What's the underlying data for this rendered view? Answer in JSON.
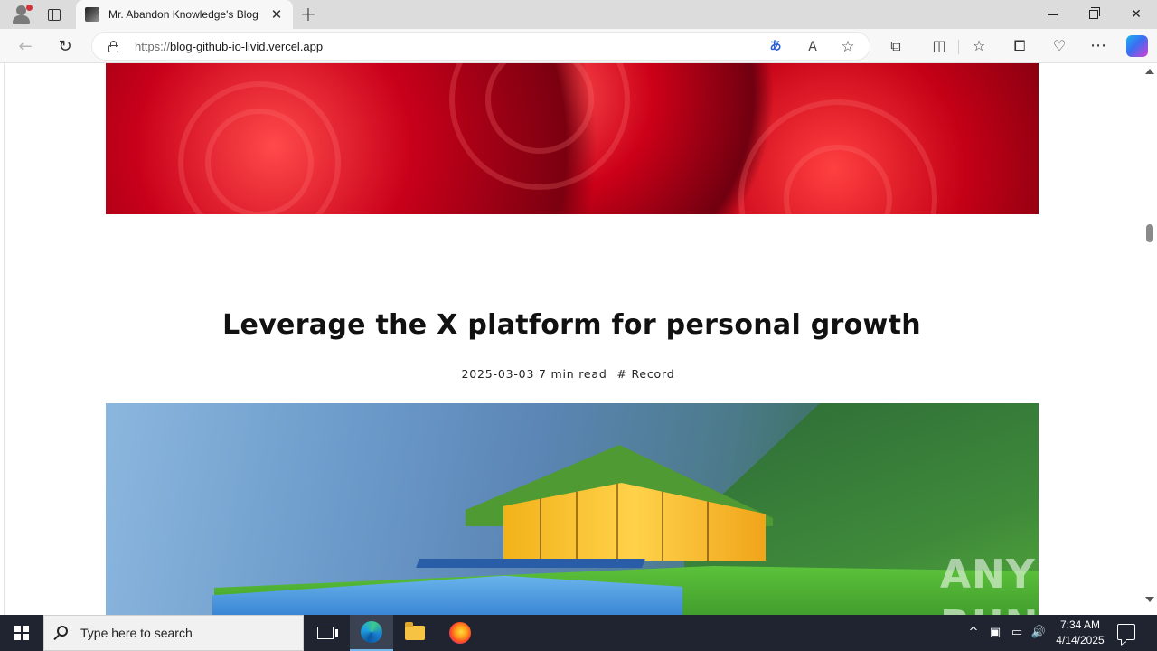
{
  "browser": {
    "tab": {
      "title": "Mr. Abandon Knowledge's Blog",
      "close_glyph": "✕"
    },
    "new_tab_glyph": "+",
    "address": {
      "protocol": "https://",
      "host": "blog-github-io-livid.vercel.app"
    },
    "icons": {
      "back": "back-arrow-icon",
      "reload": "reload-icon",
      "translate": "translate-icon",
      "read_aloud": "read-aloud-icon",
      "favorite": "star-icon",
      "extensions": "puzzle-icon",
      "split_screen": "split-screen-icon",
      "favorites": "favorites-icon",
      "collections": "collections-icon",
      "browser_essentials": "heart-pulse-icon",
      "more": "more-icon",
      "copilot": "copilot-icon"
    },
    "glyphs": {
      "back": "←",
      "reload": "↻",
      "translate": "あ",
      "read_aloud": "A",
      "favorite": "☆",
      "extensions": "⧉",
      "split_screen": "◫",
      "favorites": "☆",
      "collections": "⧠",
      "browser_essentials": "♡",
      "more": "⋯",
      "minimize": "",
      "close": "✕"
    }
  },
  "post": {
    "title": "Leverage the X platform for personal growth",
    "date": "2025-03-03",
    "read_time": "7 min read",
    "tag": "# Record"
  },
  "watermark": {
    "left": "ANY",
    "right": "RUN"
  },
  "taskbar": {
    "search_placeholder": "Type here to search",
    "tray": {
      "chevron": "^",
      "meet": "▣",
      "network": "▭",
      "volume": "🔊"
    },
    "clock": {
      "time": "7:34 AM",
      "date": "4/14/2025"
    }
  },
  "colors": {
    "titlebar": "#dcdcdc",
    "toolbar": "#f7f7f7",
    "taskbar": "#1f2430",
    "accent": "#76b9ed"
  }
}
